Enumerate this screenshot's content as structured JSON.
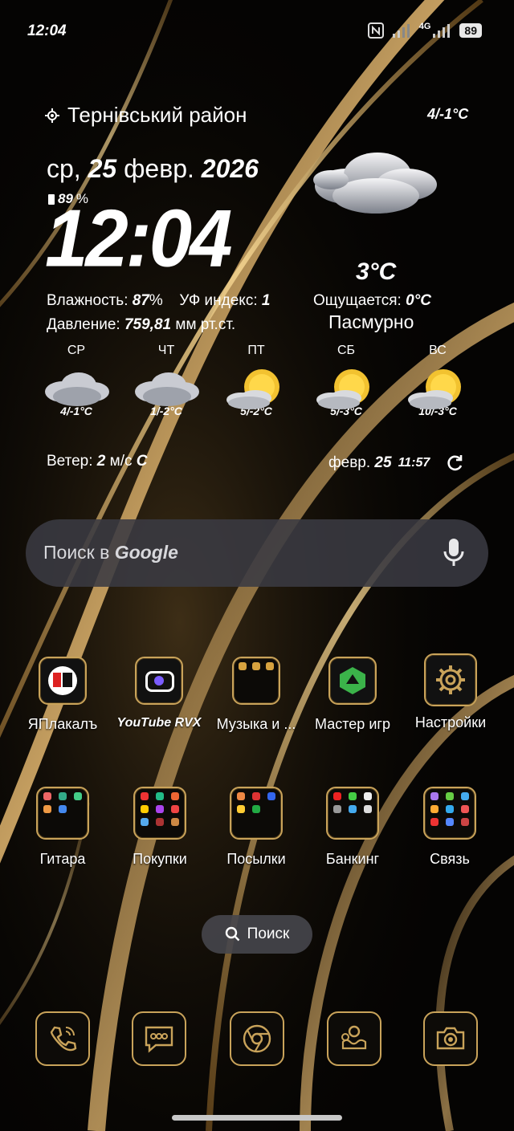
{
  "status_bar": {
    "time": "12:04",
    "battery": "89",
    "network": "4G"
  },
  "weather": {
    "location": "Тернівський район",
    "today_range": "4/-1°C",
    "date_prefix": "ср, ",
    "date_day": "25",
    "date_month": " февр. ",
    "date_year": "2026",
    "battery": "89",
    "battery_suffix": "%",
    "clock": "12:04",
    "temp": "3°C",
    "humidity_label": "Влажность: ",
    "humidity_value": "87",
    "humidity_unit": "%",
    "uv_label": "УФ индекс: ",
    "uv_value": "1",
    "feels_label": "Ощущается: ",
    "feels_value": "0°C",
    "pressure_label": "Давление: ",
    "pressure_value": "759,81",
    "pressure_unit": " мм рт.ст.",
    "condition": "Пасмурно",
    "forecast": [
      {
        "day": "СР",
        "temp": "4/-1°C",
        "icon": "cloud"
      },
      {
        "day": "ЧТ",
        "temp": "1/-2°C",
        "icon": "cloud"
      },
      {
        "day": "ПТ",
        "temp": "5/-2°C",
        "icon": "sun-cloud"
      },
      {
        "day": "СБ",
        "temp": "5/-3°C",
        "icon": "sun-cloud"
      },
      {
        "day": "ВС",
        "temp": "10/-3°C",
        "icon": "sun-cloud"
      }
    ],
    "wind_label": "Ветер: ",
    "wind_value": "2",
    "wind_unit": " м/с ",
    "wind_dir": "С",
    "updated_month": "февр. ",
    "updated_day": "25",
    "updated_time": "11:57"
  },
  "search": {
    "prefix": "Поиск в ",
    "brand": "Google"
  },
  "apps_row1": [
    {
      "label": "ЯПлакалъ",
      "icon": "yaplakal-icon"
    },
    {
      "label": "YouTube RVX",
      "icon": "youtube-icon"
    },
    {
      "label": "Музыка и ...",
      "icon": "folder-icon"
    },
    {
      "label": "Мастер игр",
      "icon": "game-cube-icon"
    },
    {
      "label": "Настройки",
      "icon": "gear-icon"
    }
  ],
  "apps_row2": [
    {
      "label": "Гитара",
      "icon": "folder-icon"
    },
    {
      "label": "Покупки",
      "icon": "folder-icon"
    },
    {
      "label": "Посылки",
      "icon": "folder-icon"
    },
    {
      "label": "Банкинг",
      "icon": "folder-icon"
    },
    {
      "label": "Связь",
      "icon": "folder-icon"
    }
  ],
  "drawer_search": {
    "label": "Поиск"
  },
  "dock": [
    {
      "icon": "phone-icon"
    },
    {
      "icon": "messages-icon"
    },
    {
      "icon": "browser-icon"
    },
    {
      "icon": "gallery-icon"
    },
    {
      "icon": "camera-icon"
    }
  ],
  "colors": {
    "accent": "#c9a35a",
    "background": "#050403"
  }
}
